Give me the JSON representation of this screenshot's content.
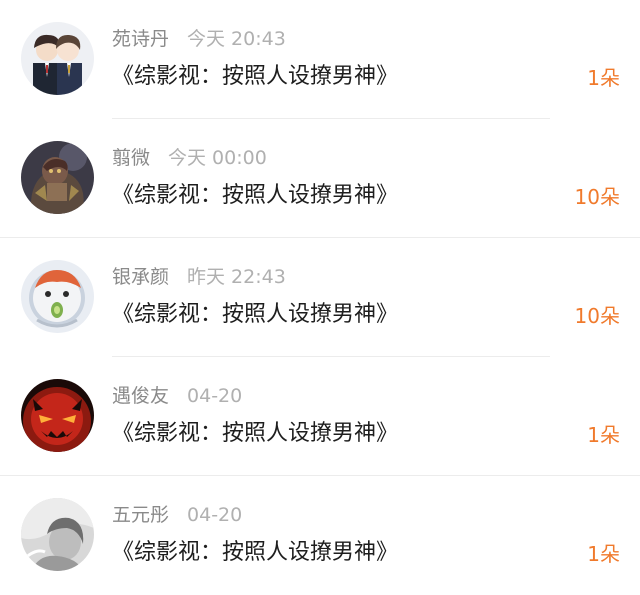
{
  "accent_color": "#f07a2c",
  "gifts": [
    {
      "name": "苑诗丹",
      "time": "今天 20:43",
      "title": "《综影视：按照人设撩男神》",
      "count": "1朵",
      "avatar": "anime-couple-avatar"
    },
    {
      "name": "翦微",
      "time": "今天 00:00",
      "title": "《综影视：按照人设撩男神》",
      "count": "10朵",
      "avatar": "armored-warrior-avatar"
    },
    {
      "name": "银承颜",
      "time": "昨天 22:43",
      "title": "《综影视：按照人设撩男神》",
      "count": "10朵",
      "avatar": "cartoon-character-avatar"
    },
    {
      "name": "遇俊友",
      "time": "04-20",
      "title": "《综影视：按照人设撩男神》",
      "count": "1朵",
      "avatar": "red-demon-face-avatar"
    },
    {
      "name": "五元彤",
      "time": "04-20",
      "title": "《综影视：按照人设撩男神》",
      "count": "1朵",
      "avatar": "grayscale-girl-avatar"
    }
  ]
}
